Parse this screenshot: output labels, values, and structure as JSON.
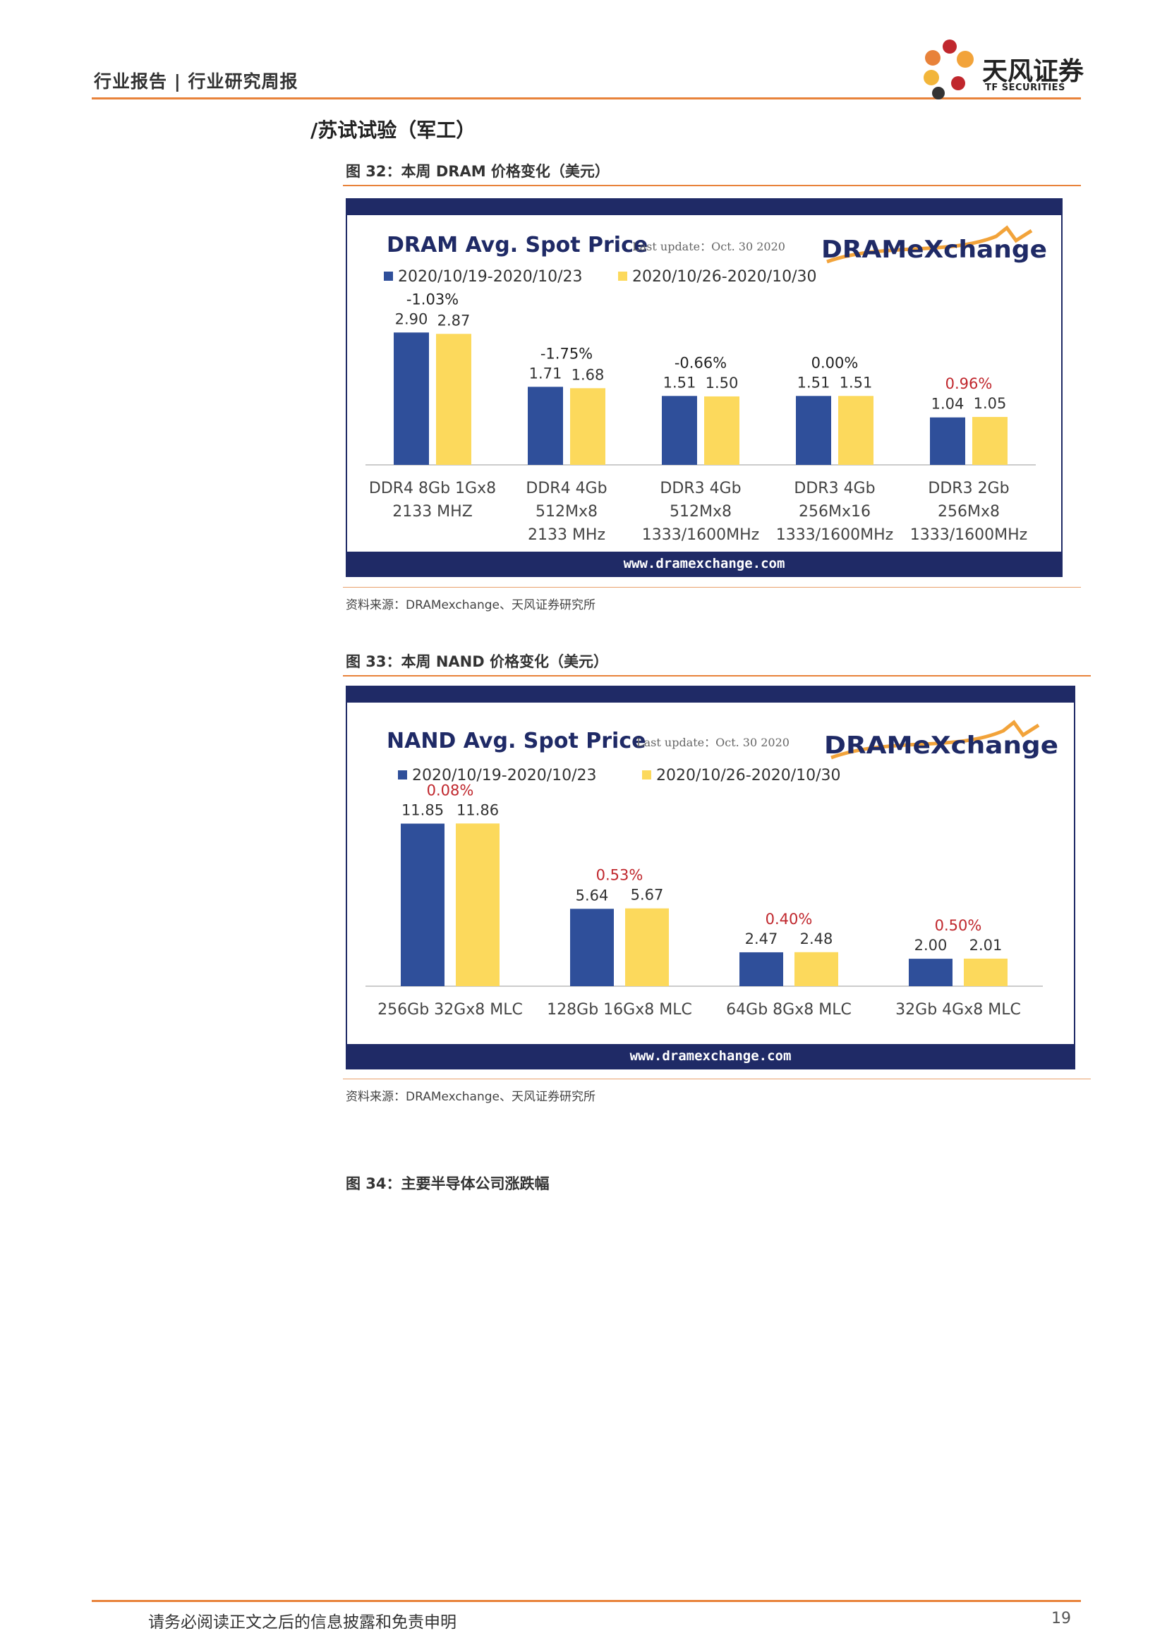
{
  "header": {
    "title": "行业报告 | 行业研究周报"
  },
  "logo": {
    "name_cn": "天风证券",
    "name_en": "TF SECURITIES"
  },
  "section_fragment": "/苏试试验（军工）",
  "figures": [
    {
      "caption": "图 32：本周 DRAM 价格变化（美元）",
      "source": "资料来源：DRAMexchange、天风证券研究所"
    },
    {
      "caption": "图 33：本周 NAND 价格变化（美元）",
      "source": "资料来源：DRAMexchange、天风证券研究所"
    },
    {
      "caption": "图 34：主要半导体公司涨跌幅"
    }
  ],
  "footer": {
    "disclaimer": "请务必阅读正文之后的信息披露和免责申明",
    "page": "19"
  },
  "colors": {
    "navy": "#1f2a66",
    "series1": "#2f4f9a",
    "series2": "#fcd95c",
    "red": "#c0272d",
    "orange": "#e8823a"
  },
  "chart_data": [
    {
      "type": "bar",
      "title": "DRAM Avg. Spot Price",
      "update": "Last update：Oct. 30  2020",
      "brand": "DRAMeXchange",
      "url": "www.dramexchange.com",
      "legend": [
        "2020/10/19-2020/10/23",
        "2020/10/26-2020/10/30"
      ],
      "categories": [
        [
          "DDR4 8Gb 1Gx8",
          "2133 MHZ"
        ],
        [
          "DDR4 4Gb",
          "512Mx8",
          "2133 MHz"
        ],
        [
          "DDR3 4Gb",
          "512Mx8",
          "1333/1600MHz"
        ],
        [
          "DDR3 4Gb",
          "256Mx16",
          "1333/1600MHz"
        ],
        [
          "DDR3 2Gb",
          "256Mx8",
          "1333/1600MHz"
        ]
      ],
      "series": [
        {
          "name": "2020/10/19-2020/10/23",
          "values": [
            2.9,
            1.71,
            1.51,
            1.51,
            1.04
          ],
          "labels": [
            "2.90",
            "1.71",
            "1.51",
            "1.51",
            "1.04"
          ]
        },
        {
          "name": "2020/10/26-2020/10/30",
          "values": [
            2.87,
            1.68,
            1.5,
            1.51,
            1.05
          ],
          "labels": [
            "2.87",
            "1.68",
            "1.50",
            "1.51",
            "1.05"
          ]
        }
      ],
      "changes": [
        "-1.03%",
        "-1.75%",
        "-0.66%",
        "0.00%",
        "0.96%"
      ],
      "change_colors": [
        "#222222",
        "#222222",
        "#222222",
        "#222222",
        "#c0272d"
      ],
      "ylim": [
        0,
        3.4
      ]
    },
    {
      "type": "bar",
      "title": "NAND Avg. Spot Price",
      "update": "Last update：Oct. 30  2020",
      "brand": "DRAMeXchange",
      "url": "www.dramexchange.com",
      "legend": [
        "2020/10/19-2020/10/23",
        "2020/10/26-2020/10/30"
      ],
      "categories": [
        [
          "256Gb 32Gx8 MLC"
        ],
        [
          "128Gb 16Gx8 MLC"
        ],
        [
          "64Gb 8Gx8 MLC"
        ],
        [
          "32Gb 4Gx8 MLC"
        ]
      ],
      "series": [
        {
          "name": "2020/10/19-2020/10/23",
          "values": [
            11.85,
            5.64,
            2.47,
            2.0
          ],
          "labels": [
            "11.85",
            "5.64",
            "2.47",
            "2.00"
          ]
        },
        {
          "name": "2020/10/26-2020/10/30",
          "values": [
            11.86,
            5.67,
            2.48,
            2.01
          ],
          "labels": [
            "11.86",
            "5.67",
            "2.48",
            "2.01"
          ]
        }
      ],
      "changes": [
        "0.08%",
        "0.53%",
        "0.40%",
        "0.50%"
      ],
      "change_colors": [
        "#c0272d",
        "#c0272d",
        "#c0272d",
        "#c0272d"
      ],
      "ylim": [
        0,
        14.5
      ]
    }
  ]
}
